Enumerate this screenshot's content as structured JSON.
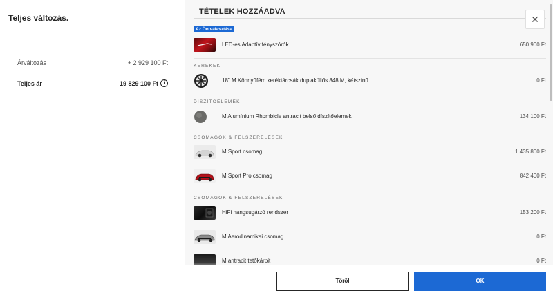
{
  "left": {
    "title": "Teljes változás.",
    "change_label": "Árváltozás",
    "change_value": "+ 2 929 100 Ft",
    "total_label": "Teljes ár",
    "total_value": "19 829 100 Ft",
    "info_glyph": "i"
  },
  "right": {
    "title": "TÉTELEK HOZZÁADVA",
    "badge": "Az Ön választása",
    "close_glyph": "✕",
    "sections": {
      "kerekek": "KEREKEK",
      "diszitoelemek": "DÍSZÍTŐELEMEK",
      "csomagok1": "CSOMAGOK & FELSZERELÉSEK",
      "csomagok2": "CSOMAGOK & FELSZERELÉSEK"
    },
    "items": [
      {
        "name": "LED-es Adaptív fényszórók",
        "price": "650 900 Ft"
      },
      {
        "name": "18\" M Könnyűfém keréktárcsák duplaküllős 848 M, kétszínű",
        "price": "0 Ft"
      },
      {
        "name": "M Alumínium Rhombicle antracit belső díszítőelemek",
        "price": "134 100 Ft"
      },
      {
        "name": "M Sport csomag",
        "price": "1 435 800 Ft"
      },
      {
        "name": "M Sport Pro csomag",
        "price": "842 400 Ft"
      },
      {
        "name": "HiFi hangsugárzó rendszer",
        "price": "153 200 Ft"
      },
      {
        "name": "M Aerodinamikai csomag",
        "price": "0 Ft"
      },
      {
        "name": "M antracit tetőkárpit",
        "price": "0 Ft"
      }
    ]
  },
  "footer": {
    "delete_label": "Töröl",
    "ok_label": "OK"
  },
  "colors": {
    "accent": "#1c69d4",
    "panel_bg": "#f7f7f7"
  }
}
